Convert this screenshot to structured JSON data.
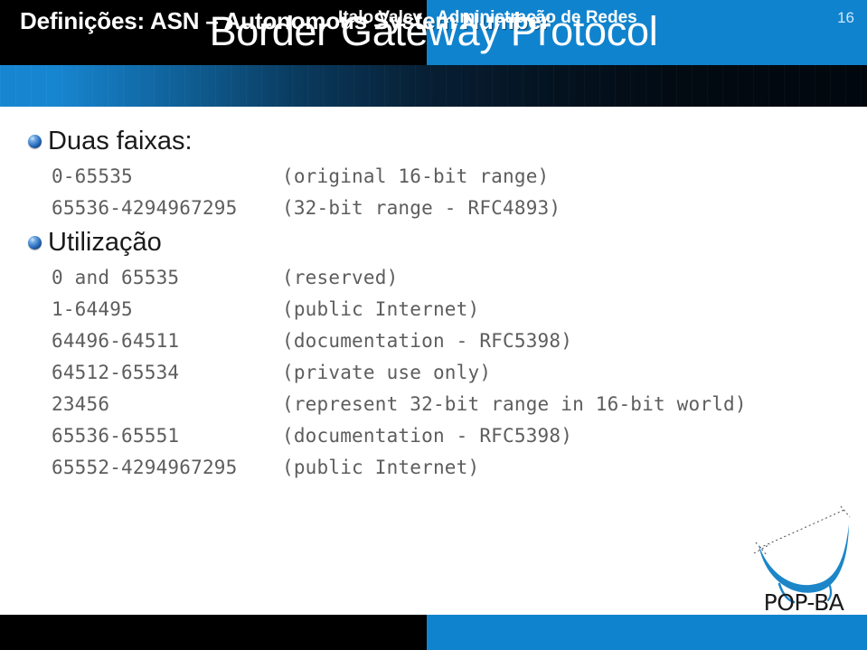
{
  "header": {
    "title": "Border Gateway Protocol",
    "subtitle": "Definições: ASN – Autonomous System Number",
    "accent_color": "#1083ce",
    "dark_color": "#000000"
  },
  "body": {
    "sections": [
      {
        "bullet_label": "Duas faixas:",
        "rows": [
          {
            "range": "0-65535",
            "note": "(original 16-bit range)"
          },
          {
            "range": "65536-4294967295",
            "note": "(32-bit range - RFC4893)"
          }
        ]
      },
      {
        "bullet_label": "Utilização",
        "rows": [
          {
            "range": "0 and 65535",
            "note": "(reserved)"
          },
          {
            "range": "1-64495",
            "note": "(public Internet)"
          },
          {
            "range": "64496-64511",
            "note": "(documentation - RFC5398)"
          },
          {
            "range": "64512-65534",
            "note": "(private use only)"
          },
          {
            "range": "23456",
            "note": "(represent 32-bit range in 16-bit world)"
          },
          {
            "range": "65536-65551",
            "note": "(documentation - RFC5398)"
          },
          {
            "range": "65552-4294967295",
            "note": "(public Internet)"
          }
        ]
      }
    ]
  },
  "logo": {
    "name": "pop-ba-logo",
    "text": "POP-BA",
    "color": "#1c86c8"
  },
  "footer": {
    "author": "Italo Valcy",
    "course": "Administração de Redes",
    "page_number": "16"
  }
}
